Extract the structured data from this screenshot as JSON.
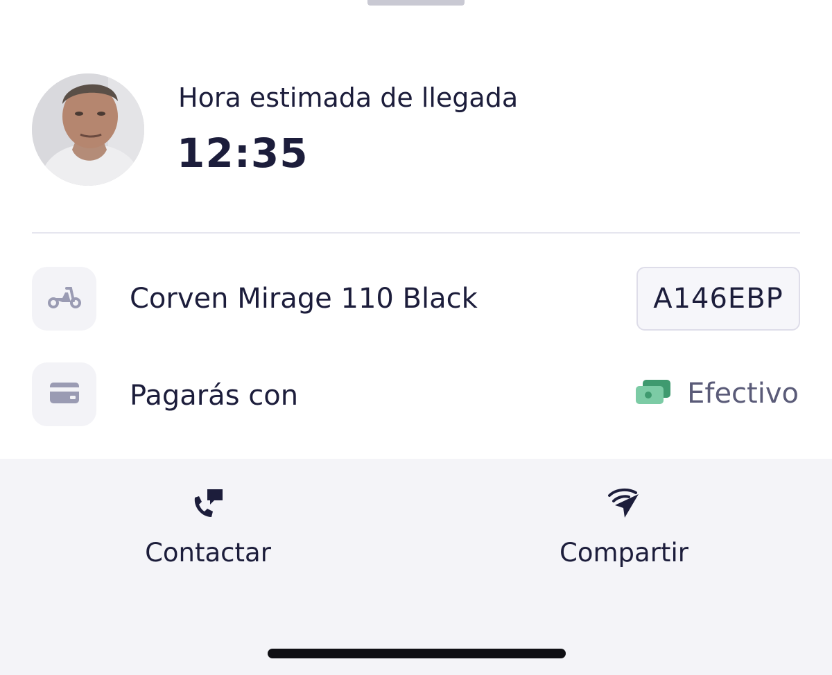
{
  "eta": {
    "label": "Hora estimada de llegada",
    "time": "12:35"
  },
  "vehicle": {
    "icon": "scooter-icon",
    "name": "Corven Mirage 110 Black",
    "plate": "A146EBP"
  },
  "payment": {
    "icon": "credit-card-icon",
    "label": "Pagarás con",
    "method_icon": "cash-icon",
    "method": "Efectivo"
  },
  "actions": {
    "contact": {
      "icon": "phone-chat-icon",
      "label": "Contactar"
    },
    "share": {
      "icon": "share-location-icon",
      "label": "Compartir"
    }
  },
  "colors": {
    "text_primary": "#1c1d3b",
    "text_secondary": "#5a5b78",
    "icon_muted": "#9a9bb3",
    "cash_green": "#3f9a6f",
    "bar_background": "#f4f4f8"
  }
}
